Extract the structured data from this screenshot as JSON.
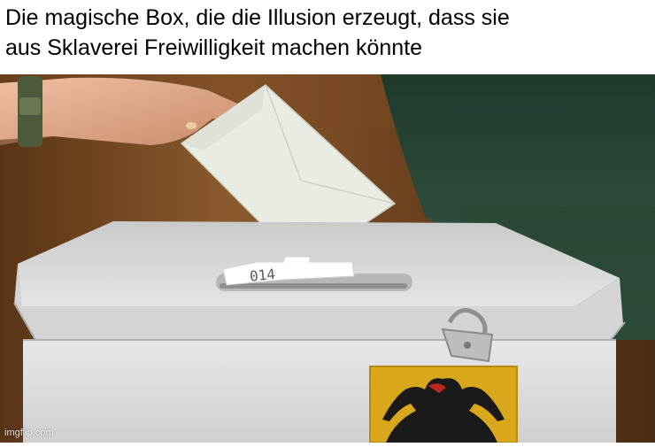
{
  "meme": {
    "caption_line1": "Die magische Box, die die Illusion erzeugt, dass sie",
    "caption_line2": "aus Sklaverei Freiwilligkeit machen könnte",
    "ballot_number": "014",
    "watermark": "imgflip.com"
  },
  "colors": {
    "background_wood": "#6e4320",
    "curtain_green": "#2f4a3a",
    "ballot_box": "#d9dadb",
    "envelope": "#e9ece2",
    "skin": "#e0a98c",
    "emblem_gold": "#d8a71c",
    "eagle_red_beak": "#c0261b"
  }
}
